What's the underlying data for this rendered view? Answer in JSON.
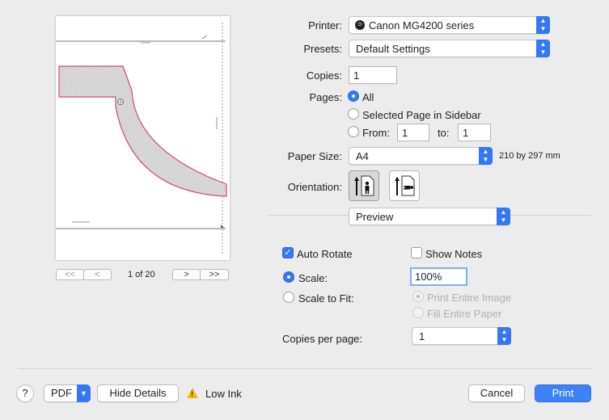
{
  "preview": {
    "page_counter": "1 of 20",
    "nav": {
      "first": "<<",
      "prev": "<",
      "next": ">",
      "last": ">>"
    }
  },
  "printer": {
    "label": "Printer:",
    "value": "Canon MG4200 series"
  },
  "presets": {
    "label": "Presets:",
    "value": "Default Settings"
  },
  "copies": {
    "label": "Copies:",
    "value": "1"
  },
  "pages": {
    "label": "Pages:",
    "all": "All",
    "selected": "Selected Page in Sidebar",
    "from_label": "From:",
    "from_value": "1",
    "to_label": "to:",
    "to_value": "1"
  },
  "paper_size": {
    "label": "Paper Size:",
    "value": "A4",
    "dimensions": "210 by 297 mm"
  },
  "orientation": {
    "label": "Orientation:"
  },
  "section_popup": {
    "value": "Preview"
  },
  "options": {
    "auto_rotate": "Auto Rotate",
    "show_notes": "Show Notes",
    "scale_label": "Scale:",
    "scale_value": "100%",
    "scale_to_fit": "Scale to Fit:",
    "print_entire_image": "Print Entire Image",
    "fill_entire_paper": "Fill Entire Paper",
    "copies_per_page_label": "Copies per page:",
    "copies_per_page_value": "1"
  },
  "footer": {
    "help": "?",
    "pdf": "PDF",
    "hide_details": "Hide Details",
    "low_ink": "Low Ink",
    "cancel": "Cancel",
    "print": "Print"
  },
  "colors": {
    "accent": "#3478f6",
    "warning": "#f5b800",
    "pipe": "#d6457a"
  }
}
